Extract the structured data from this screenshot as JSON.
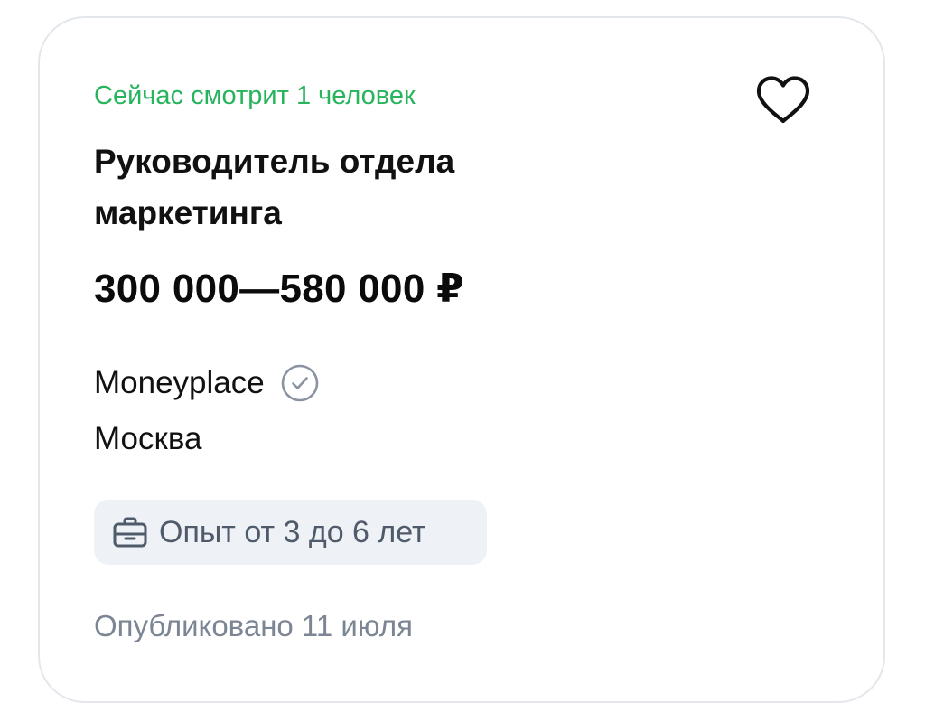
{
  "vacancy": {
    "viewers_text": "Сейчас смотрит 1 человек",
    "title": "Руководитель отдела маркетинга",
    "salary": "300 000—580 000 ₽",
    "company": "Moneyplace",
    "city": "Москва",
    "experience": "Опыт от 3 до 6 лет",
    "published": "Опубликовано 11 июля"
  },
  "icons": {
    "favorite": "heart-outline-icon",
    "verified": "check-circle-icon",
    "experience": "briefcase-icon"
  },
  "colors": {
    "viewers_green": "#27b45c",
    "text_primary": "#111111",
    "text_muted": "#7b8593",
    "chip_background": "#eef2f6",
    "card_border": "#e3e7ec"
  }
}
